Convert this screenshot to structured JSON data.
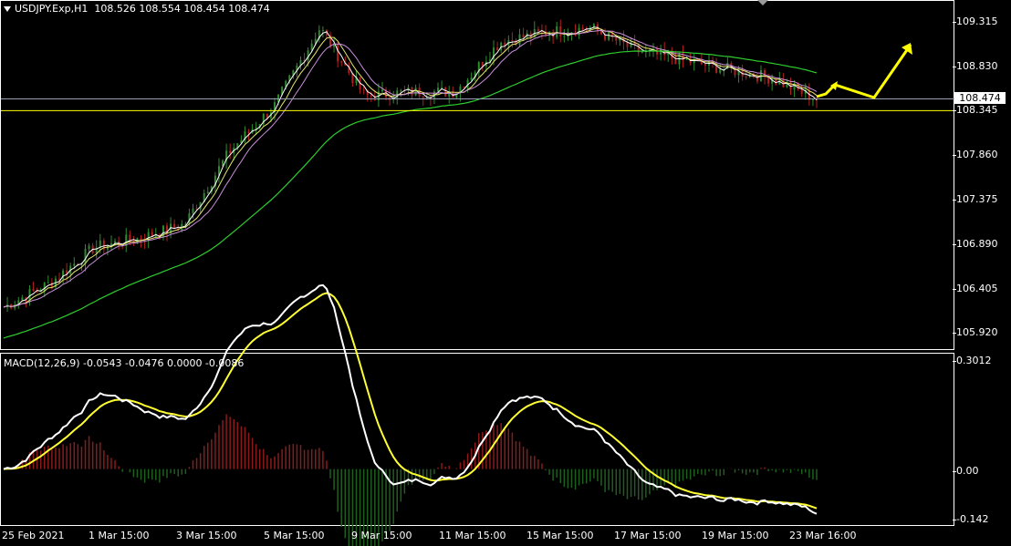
{
  "header": {
    "symbol": "USDJPY.Exp,H1",
    "ohlc": "108.526 108.554 108.454 108.474"
  },
  "price_axis": {
    "ticks": [
      "109.315",
      "108.830",
      "108.345",
      "107.860",
      "107.375",
      "106.890",
      "106.405",
      "105.920"
    ],
    "current_price": "108.474"
  },
  "macd": {
    "label": "MACD(12,26,9) -0.0543 -0.0476 0.0000 -0.0086",
    "ticks": [
      "0.3012",
      "0.00",
      "-0.142"
    ]
  },
  "time_axis": {
    "labels": [
      "25 Feb 2021",
      "1 Mar 15:00",
      "3 Mar 15:00",
      "5 Mar 15:00",
      "9 Mar 15:00",
      "11 Mar 15:00",
      "15 Mar 15:00",
      "17 Mar 15:00",
      "19 Mar 15:00",
      "23 Mar 16:00"
    ]
  },
  "colors": {
    "background": "#000000",
    "bull": "#2e8b2e",
    "bear": "#b02020",
    "ma_fast": "#ffffff",
    "ma_mid": "#e6e66e",
    "ma_slow": "#c98fd8",
    "ma_long": "#2ecc2e",
    "macd_line": "#ffffff",
    "signal_line": "#ffff33",
    "arrow": "#ffff00",
    "level_line": "#ffff00",
    "price_line": "#9aa0b4"
  },
  "chart_data": {
    "type": "line",
    "title": "USDJPY.Exp,H1",
    "ylim": [
      105.8,
      109.45
    ],
    "close_path": [
      [
        "25 Feb",
        106.2
      ],
      [
        "26 Feb",
        106.45
      ],
      [
        "1 Mar",
        106.85
      ],
      [
        "2 Mar",
        106.95
      ],
      [
        "3 Mar",
        107.1
      ],
      [
        "4 Mar",
        107.9
      ],
      [
        "5 Mar",
        108.4
      ],
      [
        "8 Mar",
        109.25
      ],
      [
        "9 Mar",
        108.5
      ],
      [
        "10 Mar",
        108.55
      ],
      [
        "11 Mar",
        108.55
      ],
      [
        "12 Mar",
        109.1
      ],
      [
        "15 Mar",
        109.2
      ],
      [
        "16 Mar",
        109.25
      ],
      [
        "17 Mar",
        109.0
      ],
      [
        "18 Mar",
        108.9
      ],
      [
        "19 Mar",
        108.8
      ],
      [
        "22 Mar",
        108.7
      ],
      [
        "23 Mar",
        108.47
      ]
    ],
    "horizontal_level": 108.345,
    "macd_ylim": [
      -0.142,
      0.3012
    ]
  }
}
